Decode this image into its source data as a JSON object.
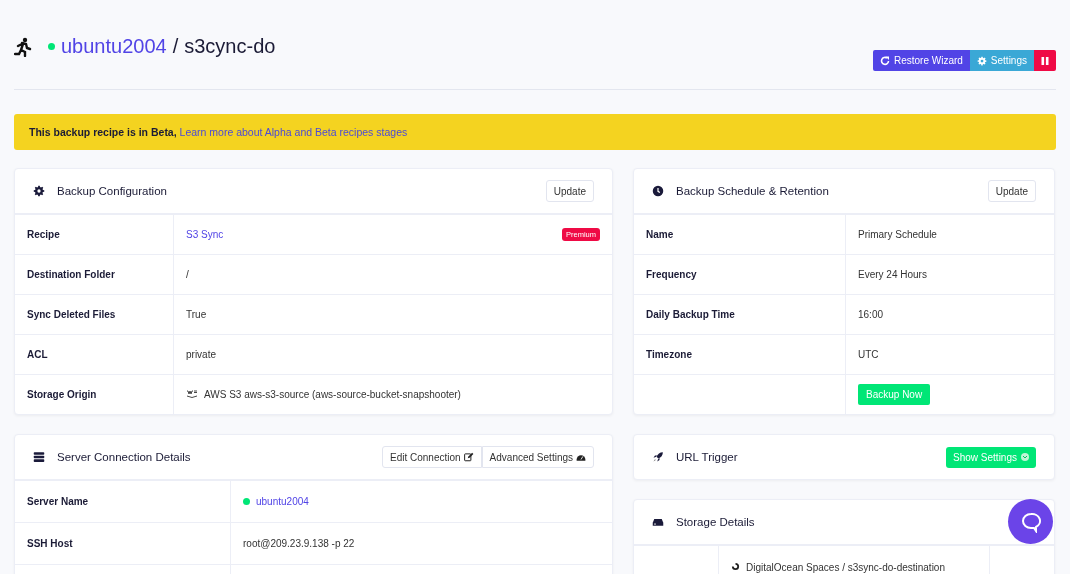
{
  "header": {
    "server": "ubuntu2004",
    "online": true,
    "separator": "/",
    "name": "s3cync-do"
  },
  "actions": [
    {
      "kind": "restore",
      "label": "Restore Wizard"
    },
    {
      "kind": "settings",
      "label": "Settings"
    },
    {
      "kind": "pause"
    }
  ],
  "banner": {
    "text": "This backup recipe is in Beta,",
    "link": "Learn more about Alpha and Beta recipes stages"
  },
  "left": [
    {
      "kind": "config",
      "title": "Backup Configuration",
      "buttons": [
        {
          "label": "Update"
        }
      ],
      "rows": [
        {
          "label": "Recipe",
          "value": "S3 Sync",
          "kind": "link",
          "badge": "Premium"
        },
        {
          "label": "Destination Folder",
          "value": "/",
          "kind": "text"
        },
        {
          "label": "Sync Deleted Files",
          "value": "True",
          "kind": "text"
        },
        {
          "label": "ACL",
          "value": "private",
          "kind": "text"
        },
        {
          "label": "Storage Origin",
          "value": "AWS S3 aws-s3-source (aws-source-bucket-snapshooter)",
          "kind": "aws"
        }
      ]
    },
    {
      "kind": "connection",
      "title": "Server Connection Details",
      "buttons": [
        {
          "label": "Edit Connection"
        },
        {
          "label": "Advanced Settings"
        }
      ],
      "rows": [
        {
          "label": "Server Name",
          "value": "ubuntu2004",
          "kind": "server",
          "online": true
        },
        {
          "label": "SSH Host",
          "value": "root@209.23.9.138 -p 22",
          "kind": "text"
        },
        {
          "kind": "blank"
        }
      ]
    }
  ],
  "right": [
    {
      "kind": "schedule",
      "title": "Backup Schedule & Retention",
      "buttons": [
        {
          "label": "Update"
        }
      ],
      "rows": [
        {
          "label": "Name",
          "value": "Primary Schedule",
          "kind": "text"
        },
        {
          "label": "Frequency",
          "value": "Every 24 Hours",
          "kind": "text"
        },
        {
          "label": "Daily Backup Time",
          "value": "16:00",
          "kind": "text"
        },
        {
          "label": "Timezone",
          "value": "UTC",
          "kind": "text"
        },
        {
          "value": "Backup Now",
          "kind": "button"
        }
      ]
    },
    {
      "kind": "trigger",
      "title": "URL Trigger",
      "toggle": {
        "label": "Show Settings"
      }
    },
    {
      "kind": "storage",
      "title": "Storage Details",
      "rows": [
        {
          "value": "DigitalOcean Spaces / s3sync-do-destination",
          "kind": "storage"
        }
      ]
    }
  ]
}
